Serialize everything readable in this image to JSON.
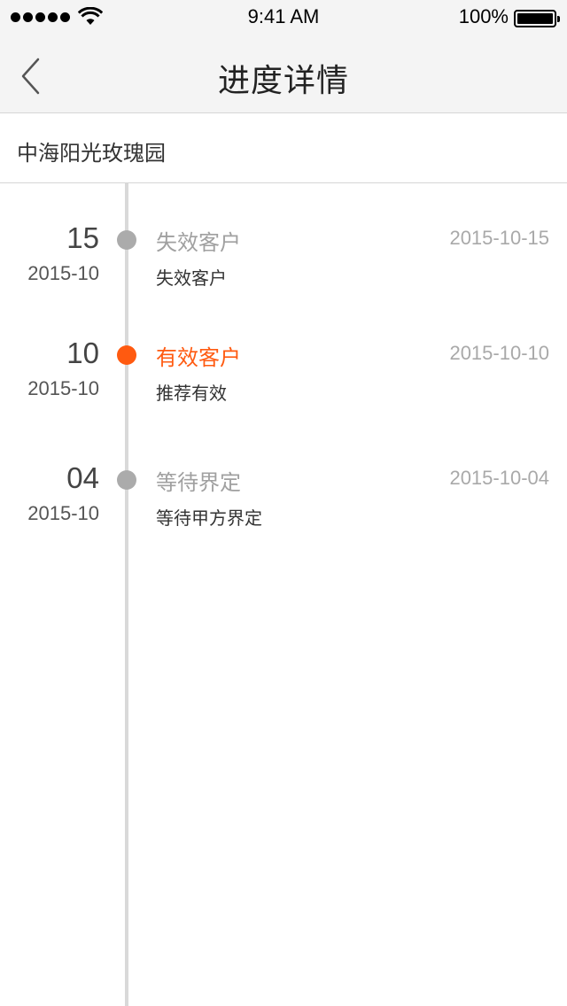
{
  "status_bar": {
    "time": "9:41 AM",
    "battery": "100%"
  },
  "nav": {
    "title": "进度详情",
    "back_icon": "chevron-left-icon"
  },
  "project": {
    "name": "中海阳光玫瑰园"
  },
  "colors": {
    "accent": "#ff5a10",
    "inactive_dot": "#ababab",
    "line": "#d9d9d9"
  },
  "timeline": [
    {
      "day": "15",
      "month": "2015-10",
      "status": "失效客户",
      "date": "2015-10-15",
      "desc": "失效客户",
      "active": false
    },
    {
      "day": "10",
      "month": "2015-10",
      "status": "有效客户",
      "date": "2015-10-10",
      "desc": "推荐有效",
      "active": true
    },
    {
      "day": "04",
      "month": "2015-10",
      "status": "等待界定",
      "date": "2015-10-04",
      "desc": "等待甲方界定",
      "active": false
    }
  ]
}
